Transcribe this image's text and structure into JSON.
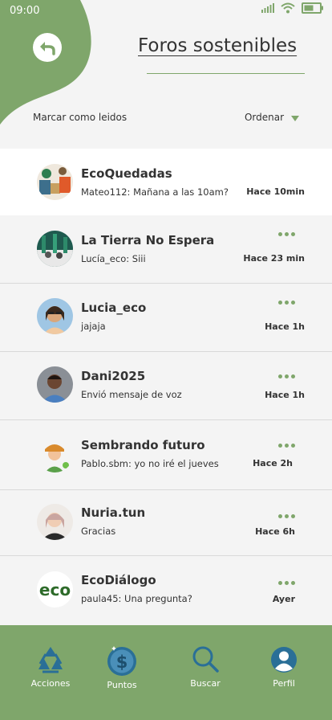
{
  "status_bar": {
    "time": "09:00"
  },
  "header": {
    "title": "Foros sostenibles"
  },
  "toolbar": {
    "mark_read_label": "Marcar como leidos",
    "sort_label": "Ordenar"
  },
  "colors": {
    "accent": "#7fa66b",
    "nav_icon": "#2a6f97",
    "background": "#f4f4f4"
  },
  "conversations": [
    {
      "name": "EcoQuedadas",
      "message": "Mateo112: Mañana a las 10am?",
      "time": "Hace 10min",
      "unread_menu": false,
      "active": true
    },
    {
      "name": "La Tierra No Espera",
      "message": "Lucía_eco: Siii",
      "time": "Hace 23 min",
      "unread_menu": true
    },
    {
      "name": "Lucia_eco",
      "message": "jajaja",
      "time": "Hace 1h",
      "unread_menu": true
    },
    {
      "name": "Dani2025",
      "message": "Envió mensaje de voz",
      "time": "Hace 1h",
      "unread_menu": true
    },
    {
      "name": "Sembrando futuro",
      "message": "Pablo.sbm: yo no iré el jueves",
      "time": "Hace 2h",
      "unread_menu": true
    },
    {
      "name": "Nuria.tun",
      "message": "Gracias",
      "time": "Hace 6h",
      "unread_menu": true
    },
    {
      "name": "EcoDiálogo",
      "message": "paula45: Una pregunta?",
      "time": "Ayer",
      "unread_menu": true,
      "logo_text": "eco"
    }
  ],
  "bottom_nav": [
    {
      "label": "Acciones",
      "icon": "recycle-icon"
    },
    {
      "label": "Puntos",
      "icon": "dollar-coin-icon"
    },
    {
      "label": "Buscar",
      "icon": "search-icon"
    },
    {
      "label": "Perfil",
      "icon": "user-icon"
    }
  ]
}
